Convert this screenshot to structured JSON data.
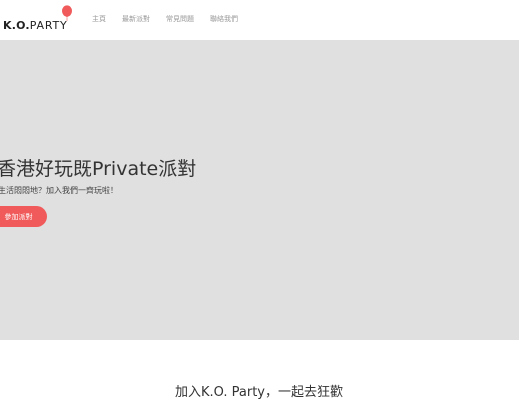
{
  "header": {
    "logo_ko": "K.O.",
    "logo_party": "PARTY",
    "balloon_color": "#f05a5a",
    "nav": [
      {
        "label": "主頁"
      },
      {
        "label": "最新派對"
      },
      {
        "label": "常見問題"
      },
      {
        "label": "聯絡我們"
      }
    ]
  },
  "hero": {
    "background": "#e0e0e0",
    "title": "香港好玩既Private派對",
    "subtitle": "生活悶悶地？加入我們一齊玩啦！",
    "button_label": "參加派對",
    "button_color": "#f05a5a"
  },
  "section": {
    "title": "加入K.O. Party，一起去狂歡"
  }
}
